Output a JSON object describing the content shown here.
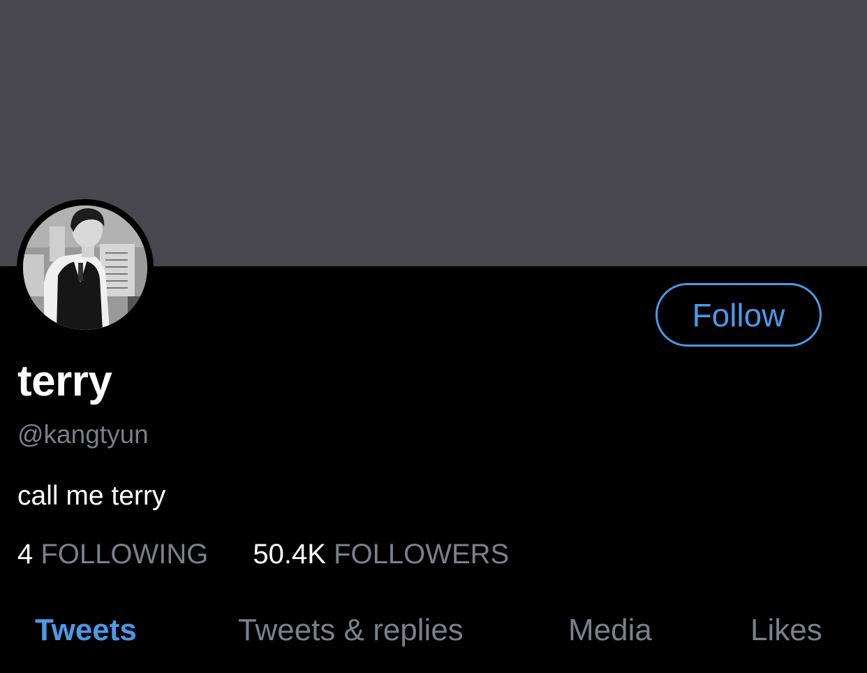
{
  "header": {
    "banner_color": "#48474d"
  },
  "profile": {
    "display_name": "terry",
    "handle": "@kangtyun",
    "bio": "call me terry",
    "follow_label": "Follow",
    "accent_color": "#4a9ae8"
  },
  "stats": {
    "following_count": "4",
    "following_label": "FOLLOWING",
    "followers_count": "50.4K",
    "followers_label": "FOLLOWERS"
  },
  "tabs": [
    {
      "label": "Tweets",
      "active": true
    },
    {
      "label": "Tweets & replies",
      "active": false
    },
    {
      "label": "Media",
      "active": false
    },
    {
      "label": "Likes",
      "active": false
    }
  ]
}
